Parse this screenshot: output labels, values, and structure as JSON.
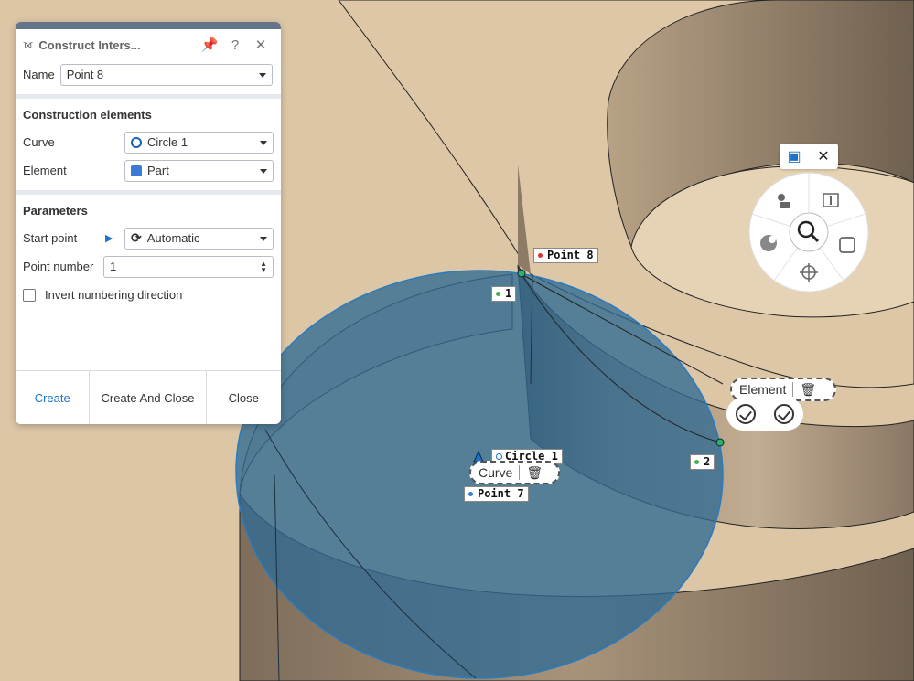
{
  "panel": {
    "title": "Construct Inters...",
    "name_label": "Name",
    "name_value": "Point 8",
    "construction_title": "Construction elements",
    "curve_label": "Curve",
    "curve_value": "Circle 1",
    "element_label": "Element",
    "element_value": "Part",
    "parameters_title": "Parameters",
    "start_point_label": "Start point",
    "start_point_value": "Automatic",
    "point_number_label": "Point number",
    "point_number_value": "1",
    "invert_label": "Invert numbering direction",
    "create_label": "Create",
    "create_close_label": "Create And Close",
    "close_label": "Close",
    "help_glyph": "?"
  },
  "viewport": {
    "tags": {
      "point8": "Point 8",
      "num1": "1",
      "num2": "2",
      "circle1": "Circle 1",
      "point7": "Point 7"
    },
    "bubble_element": "Element",
    "bubble_curve": "Curve"
  },
  "colors": {
    "background": "#dcc6a6",
    "solid_dark": "#7a6a57",
    "disc": "#3e6f93",
    "accent": "#1e73c8"
  },
  "icons": {
    "header": "intersection-icon",
    "pin": "pin-icon",
    "close": "close-icon",
    "curve": "circle-icon",
    "element": "part-icon",
    "start_point": "refresh-icon"
  }
}
